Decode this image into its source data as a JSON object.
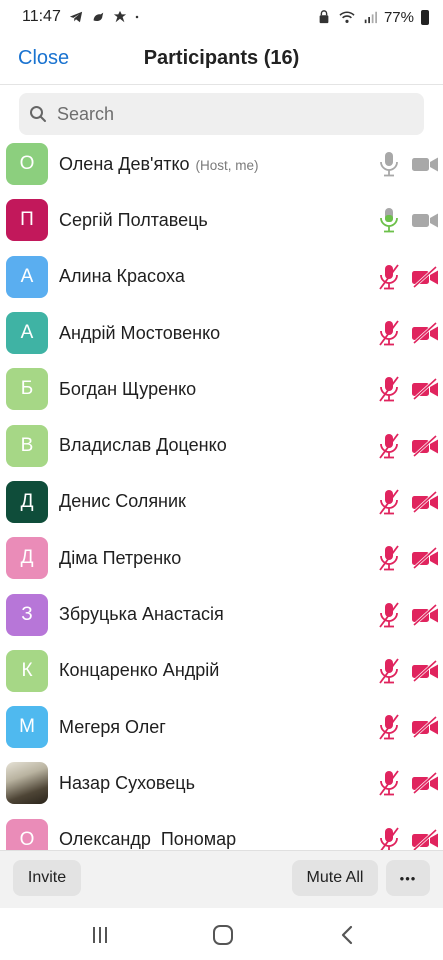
{
  "status_bar": {
    "time": "11:47",
    "battery": "77%",
    "left_icons": [
      "telegram-icon",
      "bird-icon",
      "leaf-icon",
      "dot-icon"
    ],
    "right_icons": [
      "nfc-lock-icon",
      "wifi-icon",
      "signal-icon",
      "battery-icon"
    ]
  },
  "header": {
    "close_label": "Close",
    "title": "Participants (16)"
  },
  "search": {
    "placeholder": "Search"
  },
  "participants": [
    {
      "initial": "О",
      "name": "Олена Дев'ятко",
      "tag": "(Host, me)",
      "color": "#8ccf7e",
      "mic": "on",
      "video": "on"
    },
    {
      "initial": "П",
      "name": "Сергій Полтавець",
      "tag": "",
      "color": "#c2185b",
      "mic": "speaking",
      "video": "on"
    },
    {
      "initial": "А",
      "name": "Алина Красоха",
      "tag": "",
      "color": "#5aaef0",
      "mic": "muted",
      "video": "off"
    },
    {
      "initial": "А",
      "name": "Андрій Мостовенко",
      "tag": "",
      "color": "#3fb3a4",
      "mic": "muted",
      "video": "off"
    },
    {
      "initial": "Б",
      "name": "Богдан Щуренко",
      "tag": "",
      "color": "#a6d786",
      "mic": "muted",
      "video": "off"
    },
    {
      "initial": "В",
      "name": "Владислав Доценко",
      "tag": "",
      "color": "#a6d786",
      "mic": "muted",
      "video": "off"
    },
    {
      "initial": "Д",
      "name": "Денис Соляник",
      "tag": "",
      "color": "#0f4d3a",
      "mic": "muted",
      "video": "off"
    },
    {
      "initial": "Д",
      "name": "Діма Петренко",
      "tag": "",
      "color": "#ea8cb8",
      "mic": "muted",
      "video": "off"
    },
    {
      "initial": "З",
      "name": "Збруцька Анастасія",
      "tag": "",
      "color": "#b776d8",
      "mic": "muted",
      "video": "off"
    },
    {
      "initial": "К",
      "name": "Концаренко Андрій",
      "tag": "",
      "color": "#a6d786",
      "mic": "muted",
      "video": "off"
    },
    {
      "initial": "М",
      "name": "Мегеря Олег",
      "tag": "",
      "color": "#4fb9ef",
      "mic": "muted",
      "video": "off"
    },
    {
      "initial": "",
      "name": "Назар Суховець",
      "tag": "",
      "color": "photo",
      "mic": "muted",
      "video": "off"
    },
    {
      "initial": "О",
      "name": "Олександр  Пономар",
      "tag": "",
      "color": "#ea8cb8",
      "mic": "muted",
      "video": "off"
    }
  ],
  "bottom_bar": {
    "invite_label": "Invite",
    "mute_all_label": "Mute All",
    "more_label": "•••"
  },
  "colors": {
    "accent": "#1a73d0",
    "muted_red": "#e0245e",
    "speaking_green": "#6cc04a",
    "icon_gray": "#a8a8a8"
  }
}
